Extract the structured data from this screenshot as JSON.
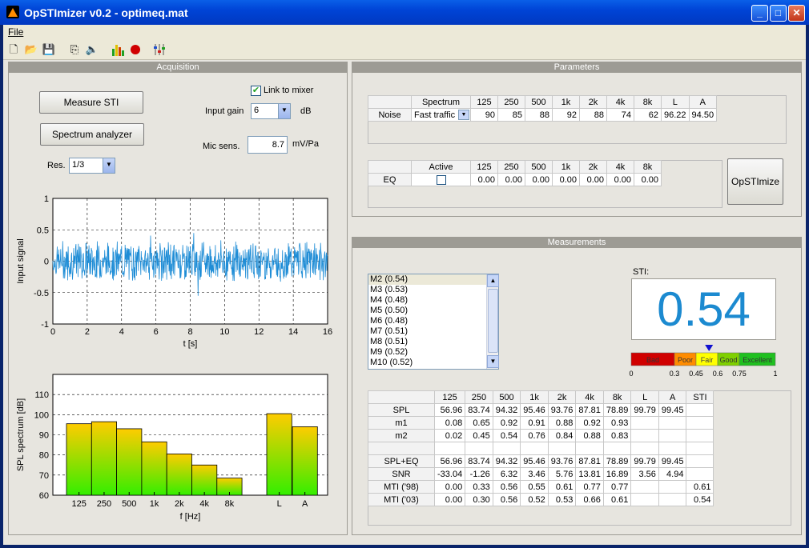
{
  "window": {
    "title": "OpSTImizer v0.2 - optimeq.mat"
  },
  "menu": {
    "file": "File"
  },
  "toolbar": [
    "new-icon",
    "open-icon",
    "save-icon",
    "import-icon",
    "speaker-icon",
    "bar-chart-icon",
    "record-icon",
    "mixer-icon"
  ],
  "acquisition": {
    "title": "Acquisition",
    "measure_button": "Measure STI",
    "spectrum_button": "Spectrum analyzer",
    "link_to_mixer": "Link to mixer",
    "link_checked": true,
    "input_gain_label": "Input gain",
    "input_gain_value": "6",
    "input_gain_unit": "dB",
    "mic_sens_label": "Mic sens.",
    "mic_sens_value": "8.7",
    "mic_sens_unit": "mV/Pa",
    "res_label": "Res.",
    "res_value": "1/3"
  },
  "parameters": {
    "title": "Parameters",
    "noise_headers": [
      "Spectrum",
      "125",
      "250",
      "500",
      "1k",
      "2k",
      "4k",
      "8k",
      "L",
      "A"
    ],
    "noise_row_label": "Noise",
    "noise_spectrum": "Fast traffic",
    "noise_values": [
      "90",
      "85",
      "88",
      "92",
      "88",
      "74",
      "62",
      "96.22",
      "94.50"
    ],
    "eq_headers": [
      "Active",
      "125",
      "250",
      "500",
      "1k",
      "2k",
      "4k",
      "8k"
    ],
    "eq_row_label": "EQ",
    "eq_values": [
      "0.00",
      "0.00",
      "0.00",
      "0.00",
      "0.00",
      "0.00",
      "0.00"
    ],
    "opstimize_button": "OpSTImize"
  },
  "measurements": {
    "title": "Measurements",
    "list": [
      "M2 (0.54)",
      "M3 (0.53)",
      "M4 (0.48)",
      "M5 (0.50)",
      "M6 (0.48)",
      "M7 (0.51)",
      "M8 (0.51)",
      "M9 (0.52)",
      "M10 (0.52)"
    ],
    "sti_label": "STI:",
    "sti_value": "0.54",
    "scale_labels": [
      "Bad",
      "Poor",
      "Fair",
      "Good",
      "Excellent"
    ],
    "scale_colors": [
      "#d00000",
      "#ff8c00",
      "#ffff00",
      "#7fd000",
      "#20c020"
    ],
    "scale_ticks": [
      "0",
      "0.3",
      "0.45",
      "0.6",
      "0.75",
      "1"
    ],
    "indicator_value": 0.54,
    "table_headers": [
      "",
      "125",
      "250",
      "500",
      "1k",
      "2k",
      "4k",
      "8k",
      "L",
      "A",
      "STI"
    ],
    "table_rows": [
      [
        "SPL",
        "56.96",
        "83.74",
        "94.32",
        "95.46",
        "93.76",
        "87.81",
        "78.89",
        "99.79",
        "99.45",
        ""
      ],
      [
        "m1",
        "0.08",
        "0.65",
        "0.92",
        "0.91",
        "0.88",
        "0.92",
        "0.93",
        "",
        "",
        ""
      ],
      [
        "m2",
        "0.02",
        "0.45",
        "0.54",
        "0.76",
        "0.84",
        "0.88",
        "0.83",
        "",
        "",
        ""
      ],
      [
        "",
        "",
        "",
        "",
        "",
        "",
        "",
        "",
        "",
        "",
        ""
      ],
      [
        "SPL+EQ",
        "56.96",
        "83.74",
        "94.32",
        "95.46",
        "93.76",
        "87.81",
        "78.89",
        "99.79",
        "99.45",
        ""
      ],
      [
        "SNR",
        "-33.04",
        "-1.26",
        "6.32",
        "3.46",
        "5.76",
        "13.81",
        "16.89",
        "3.56",
        "4.94",
        ""
      ],
      [
        "MTI ('98)",
        "0.00",
        "0.33",
        "0.56",
        "0.55",
        "0.61",
        "0.77",
        "0.77",
        "",
        "",
        "0.61"
      ],
      [
        "MTI ('03)",
        "0.00",
        "0.30",
        "0.56",
        "0.52",
        "0.53",
        "0.66",
        "0.61",
        "",
        "",
        "0.54"
      ]
    ]
  },
  "chart_data": [
    {
      "type": "line",
      "title": "",
      "xlabel": "t [s]",
      "ylabel": "Input signal",
      "xlim": [
        0,
        16
      ],
      "ylim": [
        -1,
        1
      ],
      "x_ticks": [
        "0",
        "2",
        "4",
        "6",
        "8",
        "10",
        "12",
        "14",
        "16"
      ],
      "y_ticks": [
        "1",
        "0.5",
        "0",
        "-0.5",
        "-1"
      ],
      "grid": true,
      "series": [
        {
          "description": "noise-like signal, amplitude ~0.3",
          "color": "#1f8dd6"
        }
      ]
    },
    {
      "type": "bar",
      "xlabel": "f [Hz]",
      "ylabel": "SPL spectrum [dB]",
      "ylim": [
        60,
        120
      ],
      "y_ticks": [
        "110",
        "100",
        "90",
        "80",
        "70",
        "60"
      ],
      "categories": [
        "125",
        "250",
        "500",
        "1k",
        "2k",
        "4k",
        "8k",
        "L",
        "A"
      ],
      "values": [
        95.5,
        96.5,
        93,
        86.5,
        80.5,
        75,
        68.5,
        100.5,
        94
      ],
      "grid": true
    }
  ]
}
